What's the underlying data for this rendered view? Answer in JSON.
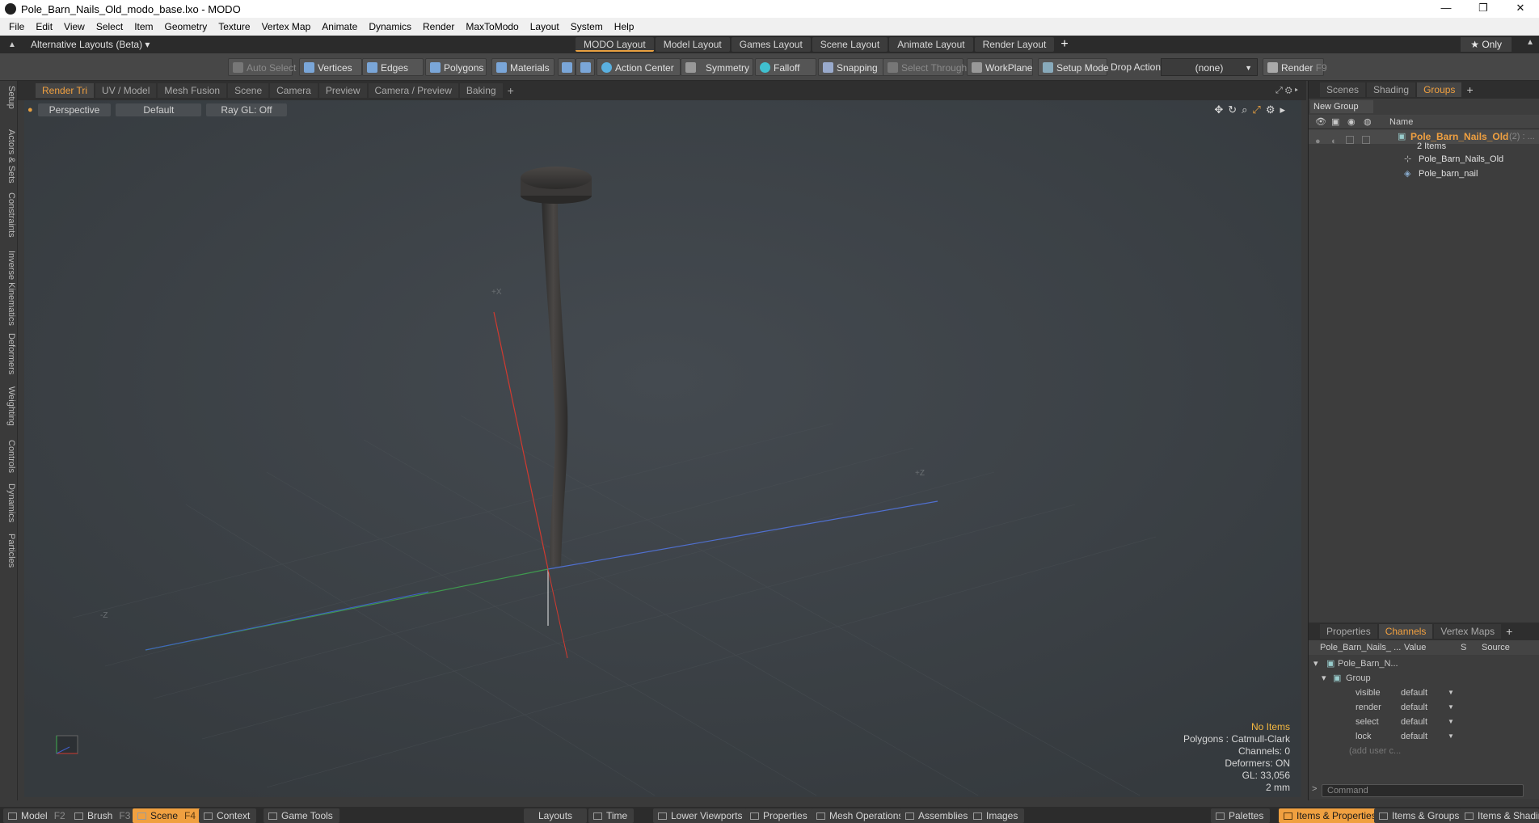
{
  "window": {
    "title": "Pole_Barn_Nails_Old_modo_base.lxo - MODO",
    "controls": [
      "—",
      "❐",
      "✕"
    ]
  },
  "menu": [
    "File",
    "Edit",
    "View",
    "Select",
    "Item",
    "Geometry",
    "Texture",
    "Vertex Map",
    "Animate",
    "Dynamics",
    "Render",
    "MaxToModo",
    "Layout",
    "System",
    "Help"
  ],
  "layoutbar": {
    "alt_layouts": "Alternative Layouts (Beta) ▾",
    "tabs": [
      "MODO Layout",
      "Model Layout",
      "Games Layout",
      "Scene Layout",
      "Animate Layout",
      "Render Layout"
    ],
    "active_tab": "MODO Layout",
    "only": "★  Only"
  },
  "toolbar": {
    "auto_select": "Auto Select",
    "vertices": "Vertices",
    "edges": "Edges",
    "polygons": "Polygons",
    "materials": "Materials",
    "action_center": "Action Center",
    "symmetry": "Symmetry",
    "falloff": "Falloff",
    "snapping": "Snapping",
    "select_through": "Select Through",
    "workplane": "WorkPlane",
    "setup_mode": "Setup Mode",
    "drop_action_label": "Drop Action",
    "drop_action_value": "(none)",
    "render": "Render",
    "render_key": "F9"
  },
  "left_tabs": [
    "Setup",
    "Actors & Sets",
    "Constraints",
    "Inverse Kinematics",
    "Deformers",
    "Weighting",
    "Controls",
    "Dynamics",
    "Particles"
  ],
  "viewport_tabs": [
    "Render Tri",
    "UV / Model",
    "Mesh Fusion",
    "Scene",
    "Camera",
    "Preview",
    "Camera / Preview",
    "Baking"
  ],
  "viewport": {
    "projection": "Perspective",
    "shading": "Default",
    "raygl": "Ray GL: Off",
    "axis_x": "+X",
    "axis_z": "+Z",
    "axis_minus_z": "-Z",
    "info": {
      "no_items": "No Items",
      "polygons": "Polygons : Catmull-Clark",
      "channels": "Channels: 0",
      "deformers": "Deformers: ON",
      "gl": "GL: 33,056",
      "scale": "2 mm"
    }
  },
  "right_tabs_top": [
    "Scenes",
    "Shading",
    "Groups"
  ],
  "groups": {
    "new_group": "New Group",
    "name_header": "Name",
    "group_name": "Pole_Barn_Nails_Old",
    "group_count": "(2) : ...",
    "items_count": "2 Items",
    "children": [
      "Pole_Barn_Nails_Old",
      "Pole_barn_nail"
    ]
  },
  "right_tabs_bottom": [
    "Properties",
    "Channels",
    "Vertex Maps"
  ],
  "channels": {
    "headers": {
      "name": "Pole_Barn_Nails_ ...",
      "value": "Value",
      "s": "S",
      "source": "Source"
    },
    "item": "Pole_Barn_N...",
    "group": "Group",
    "rows": [
      {
        "name": "visible",
        "value": "default"
      },
      {
        "name": "render",
        "value": "default"
      },
      {
        "name": "select",
        "value": "default"
      },
      {
        "name": "lock",
        "value": "default"
      }
    ],
    "add_user": "(add user c..."
  },
  "command_placeholder": "Command",
  "bottombar": {
    "left": [
      {
        "label": "Model",
        "key": "F2"
      },
      {
        "label": "Brush",
        "key": "F3"
      },
      {
        "label": "Scene",
        "key": "F4"
      },
      {
        "label": "Context",
        "key": ""
      },
      {
        "label": "Game Tools",
        "key": ""
      }
    ],
    "center": [
      "Layouts",
      "Time",
      "Lower Viewports",
      "Properties",
      "Mesh Operations",
      "Assemblies",
      "Images"
    ],
    "right": [
      "Palettes",
      "Items & Properties",
      "Items & Groups",
      "Items & Shading"
    ]
  },
  "colors": {
    "accent": "#f0a040",
    "viewport_bg": "#3d4247",
    "panel_bg": "#3a3a3a",
    "axis_x": "#d03a30",
    "axis_y": "#40b050",
    "axis_z": "#4060c8"
  }
}
